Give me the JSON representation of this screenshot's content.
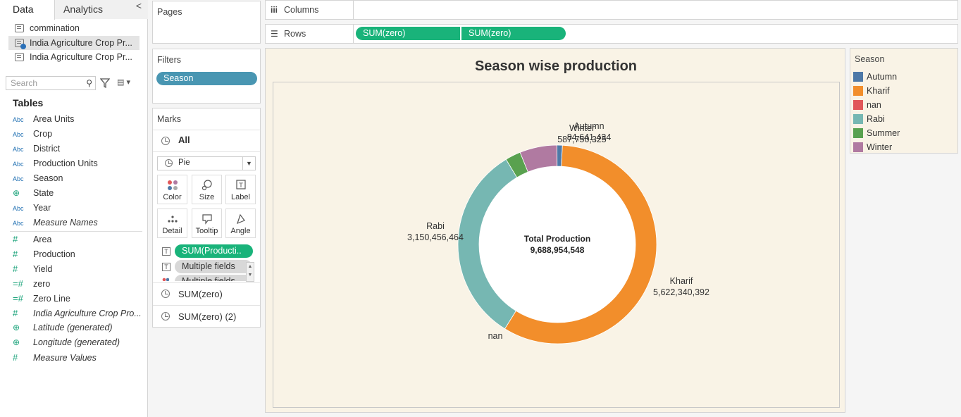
{
  "data_pane": {
    "tabs": [
      "Data",
      "Analytics"
    ],
    "collapse": "<",
    "datasources": [
      "commination",
      "India Agriculture Crop Pr...",
      "India Agriculture Crop Pr..."
    ],
    "search_placeholder": "Search",
    "tables_heading": "Tables",
    "dimensions": [
      {
        "type": "Abc",
        "name": "Area Units"
      },
      {
        "type": "Abc",
        "name": "Crop"
      },
      {
        "type": "Abc",
        "name": "District"
      },
      {
        "type": "Abc",
        "name": "Production Units"
      },
      {
        "type": "Abc",
        "name": "Season"
      },
      {
        "type": "geo",
        "name": "State"
      },
      {
        "type": "Abc",
        "name": "Year"
      },
      {
        "type": "Abc",
        "name": "Measure Names"
      }
    ],
    "measures": [
      {
        "type": "#",
        "name": "Area"
      },
      {
        "type": "#",
        "name": "Production"
      },
      {
        "type": "#",
        "name": "Yield"
      },
      {
        "type": "=#",
        "name": "zero"
      },
      {
        "type": "=#",
        "name": "Zero Line"
      },
      {
        "type": "#",
        "name": "India Agriculture Crop Pro..."
      },
      {
        "type": "geo",
        "name": "Latitude (generated)"
      },
      {
        "type": "geo",
        "name": "Longitude (generated)"
      },
      {
        "type": "#",
        "name": "Measure Values"
      }
    ]
  },
  "pages": {
    "title": "Pages"
  },
  "filters": {
    "title": "Filters",
    "pill": "Season"
  },
  "marks": {
    "title": "Marks",
    "all": "All",
    "type": "Pie",
    "buttons": [
      "Color",
      "Size",
      "Label",
      "Detail",
      "Tooltip",
      "Angle"
    ],
    "pills": [
      "SUM(Producti..",
      "Multiple fields",
      "Multiple fields"
    ],
    "layers": [
      "SUM(zero)",
      "SUM(zero) (2)"
    ]
  },
  "shelves": {
    "columns_label": "Columns",
    "rows_label": "Rows",
    "rows_pills": [
      "SUM(zero)",
      "SUM(zero)"
    ]
  },
  "chart_data": {
    "type": "pie",
    "title": "Season wise production",
    "center_label": "Total Production",
    "center_value": "9,688,954,548",
    "categories": [
      "Autumn",
      "Kharif",
      "nan",
      "Rabi",
      "Summer",
      "Winter"
    ],
    "values": [
      84641434,
      5622340392,
      0,
      3150456464,
      243765933,
      587750325
    ],
    "value_labels": [
      "84,641,434",
      "5,622,340,392",
      "",
      "3,150,456,464",
      "",
      "587,750,325"
    ],
    "colors": [
      "#4e79a7",
      "#f28e2b",
      "#e15759",
      "#76b7b2",
      "#59a14f",
      "#b07aa1"
    ],
    "legend": {
      "title": "Season",
      "placement": "right"
    }
  }
}
